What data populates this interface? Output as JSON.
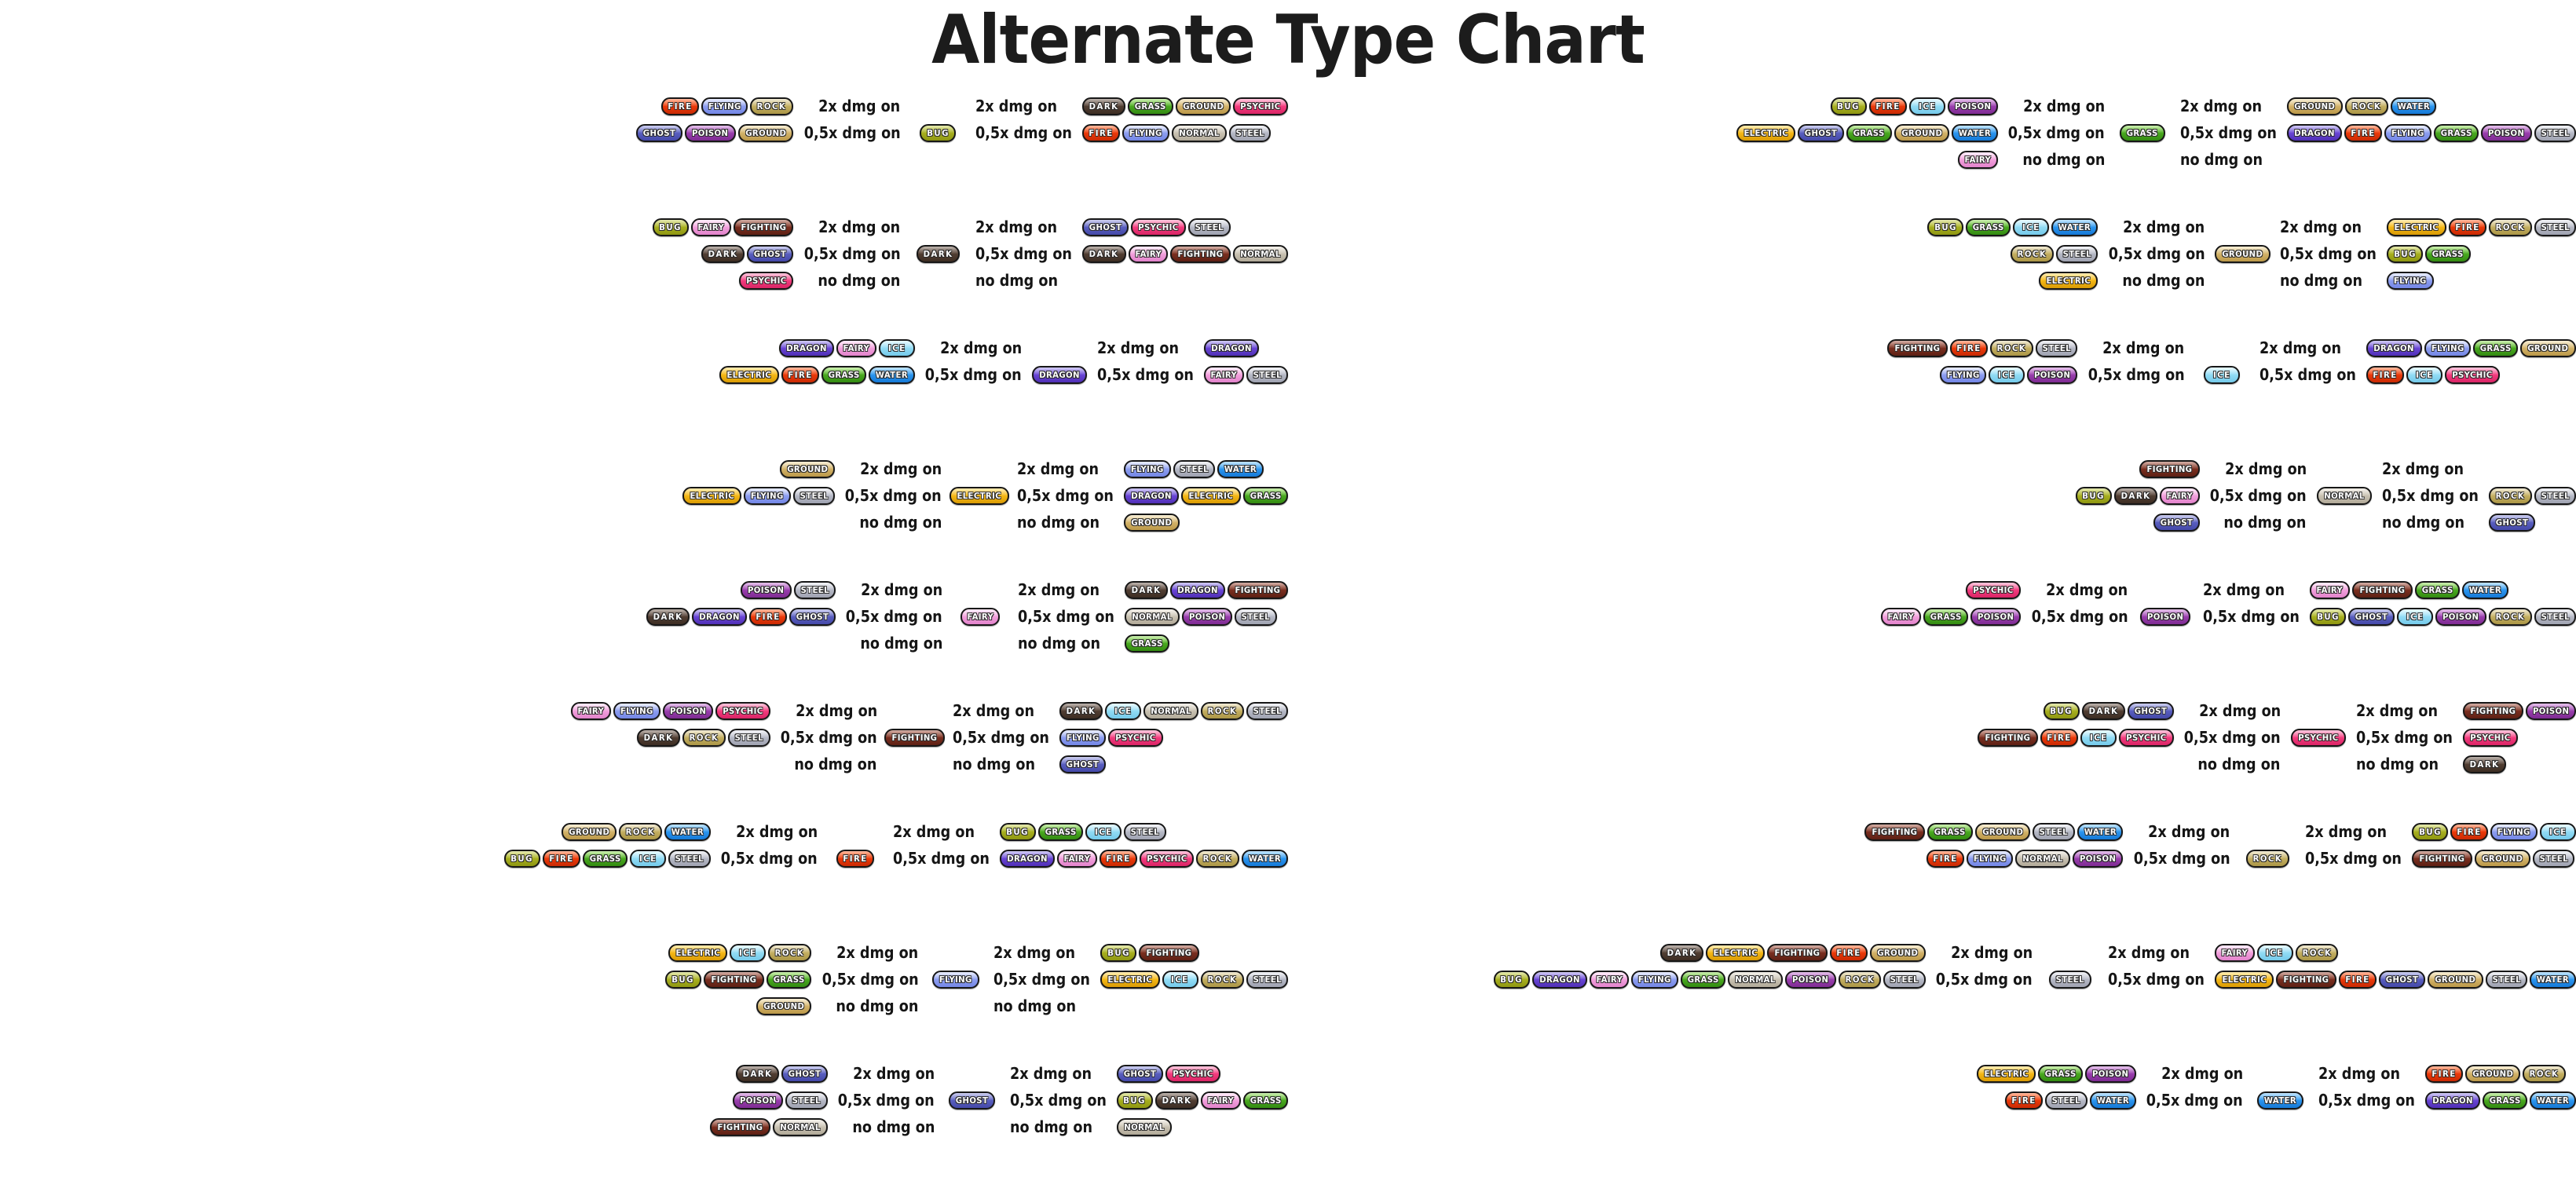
{
  "title": "Alternate Type Chart",
  "labels": {
    "super": "2x dmg on",
    "not_very": "0,5x dmg on",
    "no": "no dmg on"
  },
  "type_colors": {
    "bug": "#a8b020",
    "dark": "#523f33",
    "dragon": "#6a46d6",
    "electric": "#f5b816",
    "fairy": "#f2a0dc",
    "fighting": "#7b2f20",
    "fire": "#ec3a0a",
    "flying": "#8d9ef0",
    "ghost": "#5a5fc0",
    "grass": "#4aaa20",
    "ground": "#d3b36a",
    "ice": "#92dcf5",
    "normal": "#c9c2b2",
    "poison": "#9a3fae",
    "psychic": "#f43d7f",
    "rock": "#c4af62",
    "steel": "#b6b9c6",
    "water": "#2c96ef"
  },
  "columns": [
    {
      "blocks": [
        {
          "type": "BUG",
          "defending": {
            "super": [
              "FIRE",
              "FLYING",
              "ROCK"
            ],
            "not_very": [
              "GHOST",
              "POISON",
              "GROUND"
            ],
            "no": []
          },
          "attacking": {
            "super": [
              "DARK",
              "GRASS",
              "GROUND",
              "PSYCHIC"
            ],
            "not_very": [
              "FIRE",
              "FLYING",
              "NORMAL",
              "STEEL"
            ],
            "no": []
          }
        },
        {
          "type": "DARK",
          "defending": {
            "super": [
              "BUG",
              "FAIRY",
              "FIGHTING"
            ],
            "not_very": [
              "DARK",
              "GHOST"
            ],
            "no": [
              "PSYCHIC"
            ]
          },
          "attacking": {
            "super": [
              "GHOST",
              "PSYCHIC",
              "STEEL"
            ],
            "not_very": [
              "DARK",
              "FAIRY",
              "FIGHTING",
              "NORMAL"
            ],
            "no": []
          }
        },
        {
          "type": "DRAGON",
          "defending": {
            "super": [
              "DRAGON",
              "FAIRY",
              "ICE"
            ],
            "not_very": [
              "ELECTRIC",
              "FIRE",
              "GRASS",
              "WATER"
            ],
            "no": []
          },
          "attacking": {
            "super": [
              "DRAGON"
            ],
            "not_very": [
              "FAIRY",
              "STEEL"
            ],
            "no": []
          }
        },
        {
          "type": "ELECTRIC",
          "defending": {
            "super": [
              "GROUND"
            ],
            "not_very": [
              "ELECTRIC",
              "FLYING",
              "STEEL"
            ],
            "no": []
          },
          "attacking": {
            "super": [
              "FLYING",
              "STEEL",
              "WATER"
            ],
            "not_very": [
              "DRAGON",
              "ELECTRIC",
              "GRASS"
            ],
            "no": [
              "GROUND"
            ]
          }
        },
        {
          "type": "FAIRY",
          "defending": {
            "super": [
              "POISON",
              "STEEL"
            ],
            "not_very": [
              "DARK",
              "DRAGON",
              "FIRE",
              "GHOST"
            ],
            "no": []
          },
          "attacking": {
            "super": [
              "DARK",
              "DRAGON",
              "FIGHTING"
            ],
            "not_very": [
              "NORMAL",
              "POISON",
              "STEEL"
            ],
            "no": [
              "GRASS"
            ]
          }
        },
        {
          "type": "FIGHTING",
          "defending": {
            "super": [
              "FAIRY",
              "FLYING",
              "POISON",
              "PSYCHIC"
            ],
            "not_very": [
              "DARK",
              "ROCK",
              "STEEL"
            ],
            "no": []
          },
          "attacking": {
            "super": [
              "DARK",
              "ICE",
              "NORMAL",
              "ROCK",
              "STEEL"
            ],
            "not_very": [
              "FLYING",
              "PSYCHIC"
            ],
            "no": [
              "GHOST"
            ]
          }
        },
        {
          "type": "FIRE",
          "defending": {
            "super": [
              "GROUND",
              "ROCK",
              "WATER"
            ],
            "not_very": [
              "BUG",
              "FIRE",
              "GRASS",
              "ICE",
              "STEEL"
            ],
            "no": []
          },
          "attacking": {
            "super": [
              "BUG",
              "GRASS",
              "ICE",
              "STEEL"
            ],
            "not_very": [
              "DRAGON",
              "FAIRY",
              "FIRE",
              "PSYCHIC",
              "ROCK",
              "WATER"
            ],
            "no": []
          }
        },
        {
          "type": "FLYING",
          "defending": {
            "super": [
              "ELECTRIC",
              "ICE",
              "ROCK"
            ],
            "not_very": [
              "BUG",
              "FIGHTING",
              "GRASS"
            ],
            "no": [
              "GROUND"
            ]
          },
          "attacking": {
            "super": [
              "BUG",
              "FIGHTING"
            ],
            "not_very": [
              "ELECTRIC",
              "ICE",
              "ROCK",
              "STEEL"
            ],
            "no": []
          }
        },
        {
          "type": "GHOST",
          "defending": {
            "super": [
              "DARK",
              "GHOST"
            ],
            "not_very": [
              "POISON",
              "STEEL"
            ],
            "no": [
              "FIGHTING",
              "NORMAL"
            ]
          },
          "attacking": {
            "super": [
              "GHOST",
              "PSYCHIC"
            ],
            "not_very": [
              "BUG",
              "DARK",
              "FAIRY",
              "GRASS"
            ],
            "no": [
              "NORMAL"
            ]
          }
        }
      ]
    },
    {
      "blocks": [
        {
          "type": "GRASS",
          "defending": {
            "super": [
              "BUG",
              "FIRE",
              "ICE",
              "POISON"
            ],
            "not_very": [
              "ELECTRIC",
              "GHOST",
              "GRASS",
              "GROUND",
              "WATER"
            ],
            "no": [
              "FAIRY"
            ]
          },
          "attacking": {
            "super": [
              "GROUND",
              "ROCK",
              "WATER"
            ],
            "not_very": [
              "DRAGON",
              "FIRE",
              "FLYING",
              "GRASS",
              "POISON",
              "STEEL"
            ],
            "no": []
          }
        },
        {
          "type": "GROUND",
          "defending": {
            "super": [
              "BUG",
              "GRASS",
              "ICE",
              "WATER"
            ],
            "not_very": [
              "ROCK",
              "STEEL"
            ],
            "no": [
              "ELECTRIC"
            ]
          },
          "attacking": {
            "super": [
              "ELECTRIC",
              "FIRE",
              "ROCK",
              "STEEL"
            ],
            "not_very": [
              "BUG",
              "GRASS"
            ],
            "no": [
              "FLYING"
            ]
          }
        },
        {
          "type": "ICE",
          "defending": {
            "super": [
              "FIGHTING",
              "FIRE",
              "ROCK",
              "STEEL"
            ],
            "not_very": [
              "FLYING",
              "ICE",
              "POISON"
            ],
            "no": []
          },
          "attacking": {
            "super": [
              "DRAGON",
              "FLYING",
              "GRASS",
              "GROUND"
            ],
            "not_very": [
              "FIRE",
              "ICE",
              "PSYCHIC"
            ],
            "no": []
          }
        },
        {
          "type": "NORMAL",
          "defending": {
            "super": [
              "FIGHTING"
            ],
            "not_very": [
              "BUG",
              "DARK",
              "FAIRY"
            ],
            "no": [
              "GHOST"
            ]
          },
          "attacking": {
            "super": [],
            "not_very": [
              "ROCK",
              "STEEL"
            ],
            "no": [
              "GHOST"
            ]
          }
        },
        {
          "type": "POISON",
          "defending": {
            "super": [
              "PSYCHIC"
            ],
            "not_very": [
              "FAIRY",
              "GRASS",
              "POISON"
            ],
            "no": []
          },
          "attacking": {
            "super": [
              "FAIRY",
              "FIGHTING",
              "GRASS",
              "WATER"
            ],
            "not_very": [
              "BUG",
              "GHOST",
              "ICE",
              "POISON",
              "ROCK",
              "STEEL"
            ],
            "no": []
          }
        },
        {
          "type": "PSYCHIC",
          "defending": {
            "super": [
              "BUG",
              "DARK",
              "GHOST"
            ],
            "not_very": [
              "FIGHTING",
              "FIRE",
              "ICE",
              "PSYCHIC"
            ],
            "no": []
          },
          "attacking": {
            "super": [
              "FIGHTING",
              "POISON"
            ],
            "not_very": [
              "PSYCHIC"
            ],
            "no": [
              "DARK"
            ]
          }
        },
        {
          "type": "ROCK",
          "defending": {
            "super": [
              "FIGHTING",
              "GRASS",
              "GROUND",
              "STEEL",
              "WATER"
            ],
            "not_very": [
              "FIRE",
              "FLYING",
              "NORMAL",
              "POISON"
            ],
            "no": []
          },
          "attacking": {
            "super": [
              "BUG",
              "FIRE",
              "FLYING",
              "ICE"
            ],
            "not_very": [
              "FIGHTING",
              "GROUND",
              "STEEL"
            ],
            "no": []
          }
        },
        {
          "type": "STEEL",
          "defending": {
            "super": [
              "DARK",
              "ELECTRIC",
              "FIGHTING",
              "FIRE",
              "GROUND"
            ],
            "not_very": [
              "BUG",
              "DRAGON",
              "FAIRY",
              "FLYING",
              "GRASS",
              "NORMAL",
              "POISON",
              "ROCK",
              "STEEL"
            ],
            "no": []
          },
          "attacking": {
            "super": [
              "FAIRY",
              "ICE",
              "ROCK"
            ],
            "not_very": [
              "ELECTRIC",
              "FIGHTING",
              "FIRE",
              "GHOST",
              "GROUND",
              "STEEL",
              "WATER"
            ],
            "no": []
          }
        },
        {
          "type": "WATER",
          "defending": {
            "super": [
              "ELECTRIC",
              "GRASS",
              "POISON"
            ],
            "not_very": [
              "FIRE",
              "STEEL",
              "WATER"
            ],
            "no": []
          },
          "attacking": {
            "super": [
              "FIRE",
              "GROUND",
              "ROCK"
            ],
            "not_very": [
              "DRAGON",
              "GRASS",
              "WATER"
            ],
            "no": []
          }
        }
      ]
    }
  ]
}
